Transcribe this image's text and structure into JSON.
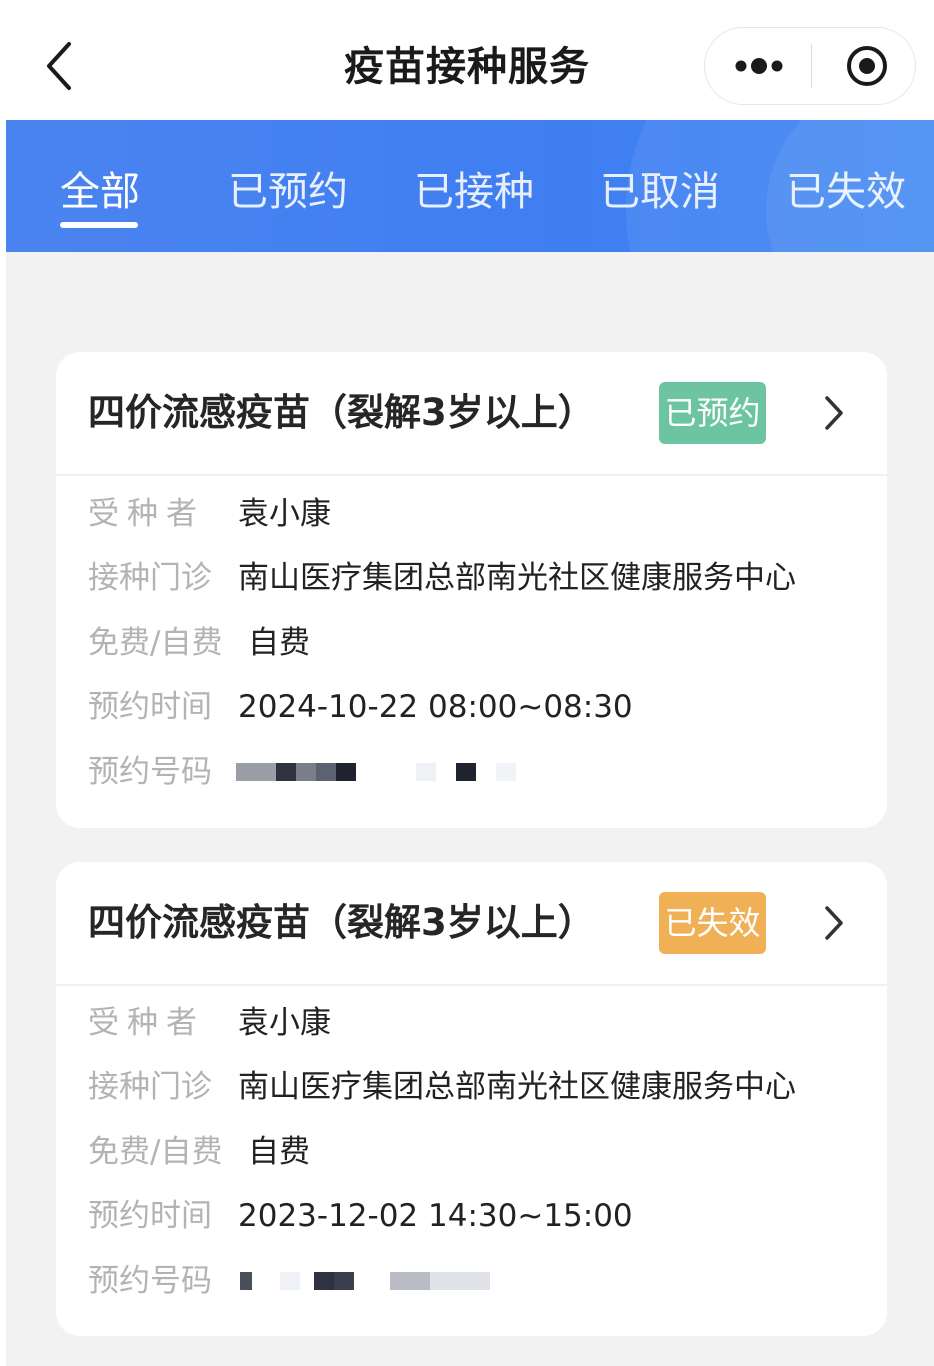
{
  "navbar": {
    "title": "疫苗接种服务",
    "back_icon": "chevron-left-icon",
    "more_icon": "more-dots-icon",
    "close_icon": "target-circle-icon"
  },
  "tabs": [
    {
      "label": "全部",
      "active": true
    },
    {
      "label": "已预约",
      "active": false
    },
    {
      "label": "已接种",
      "active": false
    },
    {
      "label": "已取消",
      "active": false
    },
    {
      "label": "已失效",
      "active": false
    }
  ],
  "colors": {
    "tabbar": "#4383f1",
    "badge_booked": "#6cc4a1",
    "badge_expired": "#f0b056",
    "label": "#b3b3b3",
    "value": "#222222"
  },
  "labels": {
    "recipient": "受种者",
    "clinic": "接种门诊",
    "fee": "免费/自费",
    "time": "预约时间",
    "number": "预约号码"
  },
  "appointments": [
    {
      "vaccine": "四价流感疫苗（裂解3岁以上）",
      "status": "已预约",
      "recipient": "袁小康",
      "clinic": "南山医疗集团总部南光社区健康服务中心",
      "fee_type": "自费",
      "time": "2024-10-22 08:00~08:30",
      "number_masked": true
    },
    {
      "vaccine": "四价流感疫苗（裂解3岁以上）",
      "status": "已失效",
      "recipient": "袁小康",
      "clinic": "南山医疗集团总部南光社区健康服务中心",
      "fee_type": "自费",
      "time": "2023-12-02 14:30~15:00",
      "number_masked": true
    }
  ]
}
